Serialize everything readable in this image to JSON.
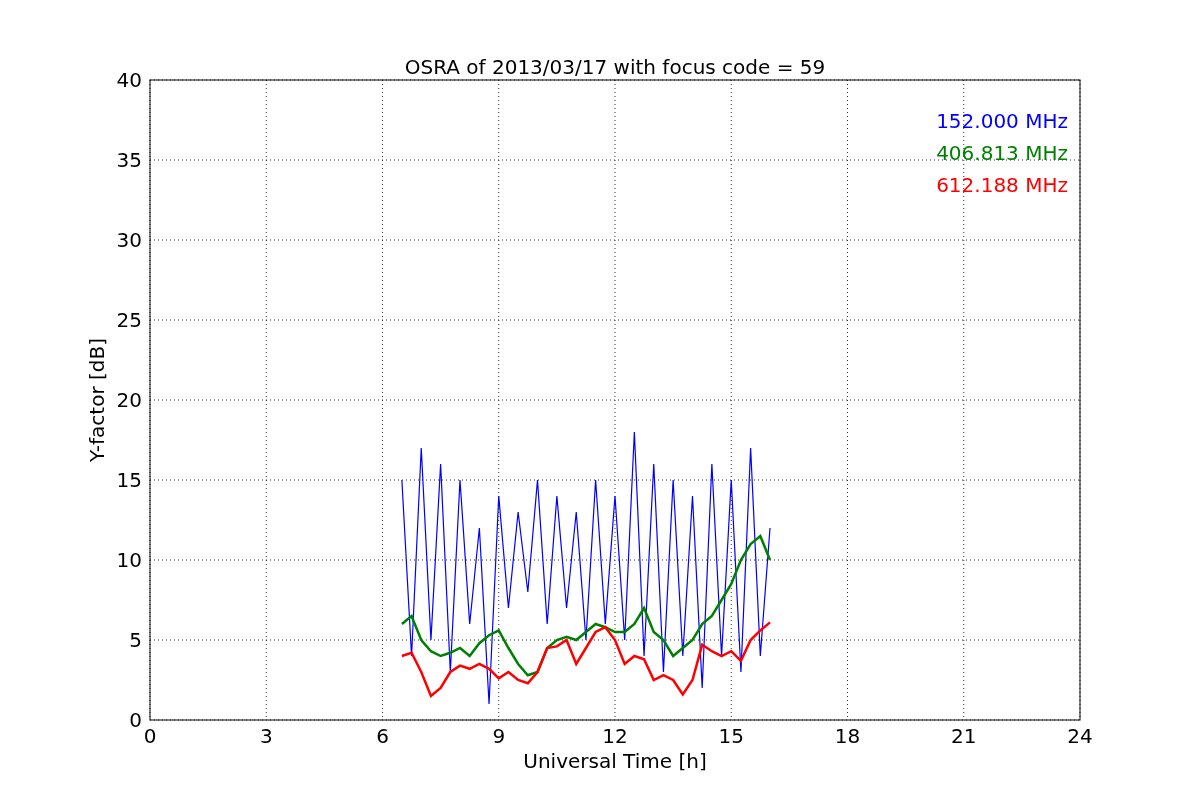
{
  "figure": {
    "chart_data": {
      "type": "line",
      "title": "OSRA of 2013/03/17 with focus code = 59",
      "xlabel": "Universal Time [h]",
      "ylabel": "Y-factor [dB]",
      "x": [
        6.5,
        6.75,
        7,
        7.25,
        7.5,
        7.75,
        8,
        8.25,
        8.5,
        8.75,
        9,
        9.25,
        9.5,
        9.75,
        10,
        10.25,
        10.5,
        10.75,
        11,
        11.25,
        11.5,
        11.75,
        12,
        12.25,
        12.5,
        12.75,
        13,
        13.25,
        13.5,
        13.75,
        14,
        14.25,
        14.5,
        14.75,
        15,
        15.25,
        15.5,
        15.75,
        16
      ],
      "series": [
        {
          "name": "152.000 MHz",
          "color": "#0000ff",
          "values": [
            15,
            4,
            17,
            5,
            16,
            3,
            15,
            6,
            12,
            1,
            14,
            7,
            13,
            8,
            15,
            6,
            14,
            7,
            13,
            5,
            15,
            6,
            14,
            5,
            18,
            4,
            16,
            3,
            15,
            4,
            14,
            2,
            16,
            4,
            15,
            3,
            17,
            4,
            12
          ]
        },
        {
          "name": "406.813 MHz",
          "color": "#008000",
          "values": [
            6,
            6.5,
            5,
            4.3,
            4,
            4.2,
            4.5,
            4,
            4.8,
            5.3,
            5.6,
            4.5,
            3.5,
            2.8,
            3,
            4.5,
            5,
            5.2,
            5,
            5.5,
            6,
            5.8,
            5.5,
            5.5,
            6,
            7,
            5.5,
            5,
            4,
            4.5,
            5,
            6,
            6.5,
            7.5,
            8.5,
            10,
            11,
            11.5,
            10
          ]
        },
        {
          "name": "612.188 MHz",
          "color": "#ff0000",
          "values": [
            4,
            4.2,
            3,
            1.5,
            2,
            3,
            3.4,
            3.2,
            3.5,
            3.2,
            2.6,
            3,
            2.5,
            2.3,
            3,
            4.5,
            4.6,
            5,
            3.5,
            4.5,
            5.5,
            5.8,
            5,
            3.5,
            4,
            3.8,
            2.5,
            2.8,
            2.5,
            1.6,
            2.5,
            4.7,
            4.3,
            4,
            4.3,
            3.7,
            5,
            5.6,
            6.1
          ]
        }
      ],
      "grid": true,
      "xlim": [
        0,
        24
      ],
      "ylim": [
        0,
        40
      ],
      "xticks": [
        0,
        3,
        6,
        9,
        12,
        15,
        18,
        21,
        24
      ],
      "yticks": [
        0,
        5,
        10,
        15,
        20,
        25,
        30,
        35,
        40
      ]
    }
  }
}
